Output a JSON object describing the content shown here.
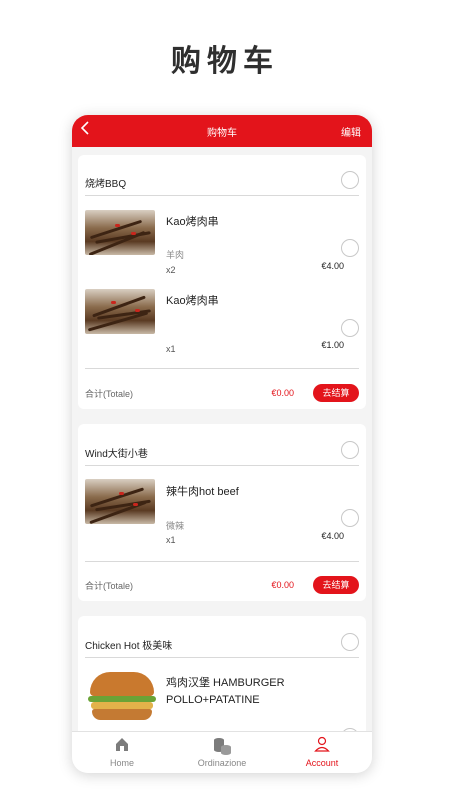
{
  "page_title": "购物车",
  "topbar": {
    "back_icon": "chevron-left-icon",
    "title": "购物车",
    "edit": "编辑"
  },
  "stores": [
    {
      "name": "烧烤BBQ",
      "items": [
        {
          "name": "Kao烤肉串",
          "spec": "羊肉",
          "qty": "x2",
          "price": "€4.00"
        },
        {
          "name": "Kao烤肉串",
          "spec": "",
          "qty": "x1",
          "price": "€1.00"
        }
      ],
      "total_label": "合计(Totale)",
      "total": "€0.00",
      "checkout": "去结算"
    },
    {
      "name": "Wind大街小巷",
      "items": [
        {
          "name": "辣牛肉hot beef",
          "spec": "微辣",
          "qty": "x1",
          "price": "€4.00"
        }
      ],
      "total_label": "合计(Totale)",
      "total": "€0.00",
      "checkout": "去结算"
    },
    {
      "name": "Chicken Hot 极美味",
      "items": [
        {
          "name_line1": "鸡肉汉堡 HAMBURGER",
          "name_line2": "POLLO+PATATINE"
        }
      ]
    }
  ],
  "tabs": [
    {
      "label": "Home",
      "icon": "home-icon",
      "active": false
    },
    {
      "label": "Ordinazione",
      "icon": "coins-icon",
      "active": false
    },
    {
      "label": "Account",
      "icon": "user-icon",
      "active": true
    }
  ],
  "colors": {
    "accent": "#e3141b",
    "background": "#f4f4f4"
  }
}
